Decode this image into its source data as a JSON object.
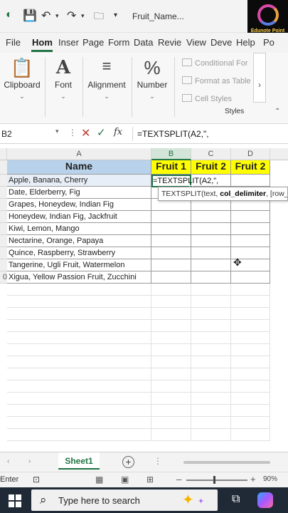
{
  "window": {
    "title": "Fruit_Name..."
  },
  "ribbon_tabs": [
    "File",
    "Hom",
    "Inser",
    "Page",
    "Form",
    "Data",
    "Revie",
    "View",
    "Deve",
    "Help",
    "Po"
  ],
  "ribbon": {
    "clipboard": "Clipboard",
    "font": "Font",
    "alignment": "Alignment",
    "number": "Number",
    "conditional_formatting": "Conditional For",
    "format_as_table": "Format as Table",
    "cell_styles": "Cell Styles",
    "styles_label": "Styles"
  },
  "formula_bar": {
    "name_box": "B2",
    "fx": "fx",
    "formula": "=TEXTSPLIT(A2,\","
  },
  "columns": [
    "A",
    "B",
    "C",
    "D"
  ],
  "header_row": {
    "row_label": "",
    "name": "Name",
    "fruit1": "Fruit 1",
    "fruit2a": "Fruit 2",
    "fruit2b": "Fruit 2"
  },
  "rows": [
    {
      "num": "",
      "name": "Apple, Banana, Cherry"
    },
    {
      "num": "",
      "name": "Date, Elderberry, Fig"
    },
    {
      "num": "",
      "name": "Grapes, Honeydew, Indian Fig"
    },
    {
      "num": "",
      "name": "Honeydew, Indian Fig, Jackfruit"
    },
    {
      "num": "",
      "name": "Kiwi, Lemon, Mango"
    },
    {
      "num": "",
      "name": "Nectarine, Orange, Papaya"
    },
    {
      "num": "",
      "name": "Quince, Raspberry, Strawberry"
    },
    {
      "num": "",
      "name": "Tangerine, Ugli Fruit, Watermelon"
    },
    {
      "num": "0",
      "name": "Xigua, Yellow Passion Fruit, Zucchini"
    }
  ],
  "active_cell_text": "=TEXTSPLIT(A2,\",",
  "tooltip": {
    "fn": "TEXTSPLIT(text, ",
    "bold_arg": "col_delimiter",
    "rest": ", [row_"
  },
  "sheet_tab": "Sheet1",
  "status": {
    "mode": "Enter",
    "zoom": "90%"
  },
  "taskbar": {
    "search_placeholder": "Type here to search"
  },
  "logo": {
    "text": "Edunote Point"
  }
}
